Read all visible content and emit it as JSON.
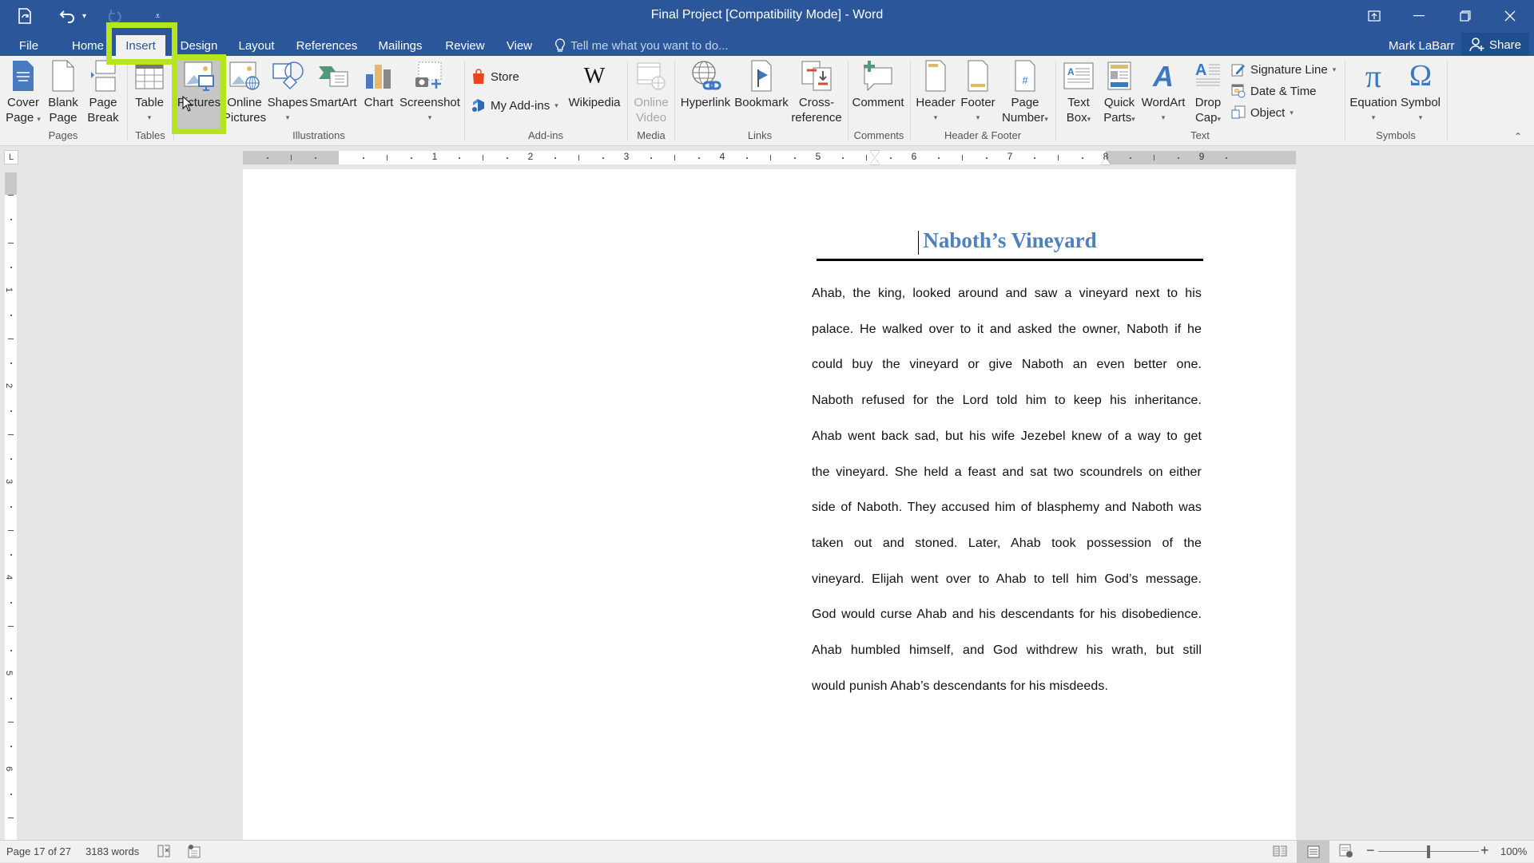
{
  "window": {
    "title": "Final Project [Compatibility Mode] - Word",
    "user": "Mark LaBarr",
    "share_label": "Share",
    "tell_me_placeholder": "Tell me what you want to do...",
    "qat": {
      "save_icon": "autosave-icon",
      "undo_icon": "undo-icon",
      "redo_icon": "redo-icon",
      "customize_icon": "customize-qat-icon"
    },
    "controls": [
      "ribbon-display-options",
      "minimize",
      "restore",
      "close"
    ]
  },
  "tabs": [
    {
      "label": "File"
    },
    {
      "label": "Home"
    },
    {
      "label": "Insert",
      "active": true
    },
    {
      "label": "Design"
    },
    {
      "label": "Layout"
    },
    {
      "label": "References"
    },
    {
      "label": "Mailings"
    },
    {
      "label": "Review"
    },
    {
      "label": "View"
    }
  ],
  "ribbon": {
    "groups": {
      "pages": "Pages",
      "tables": "Tables",
      "illustrations": "Illustrations",
      "addins": "Add-ins",
      "media": "Media",
      "links": "Links",
      "comments": "Comments",
      "header_footer": "Header & Footer",
      "text": "Text",
      "symbols": "Symbols"
    },
    "buttons": {
      "cover_page": [
        "Cover",
        "Page"
      ],
      "blank_page": [
        "Blank",
        "Page"
      ],
      "page_break": [
        "Page",
        "Break"
      ],
      "table": "Table",
      "pictures": "Pictures",
      "online_pictures": [
        "Online",
        "Pictures"
      ],
      "shapes": "Shapes",
      "smartart": "SmartArt",
      "chart": "Chart",
      "screenshot": "Screenshot",
      "store": "Store",
      "my_addins": "My Add-ins",
      "wikipedia": "Wikipedia",
      "online_video": [
        "Online",
        "Video"
      ],
      "hyperlink": "Hyperlink",
      "bookmark": "Bookmark",
      "cross_reference": [
        "Cross-",
        "reference"
      ],
      "comment": "Comment",
      "header": "Header",
      "footer": "Footer",
      "page_number": [
        "Page",
        "Number"
      ],
      "text_box": [
        "Text",
        "Box"
      ],
      "quick_parts": [
        "Quick",
        "Parts"
      ],
      "wordart": "WordArt",
      "drop_cap": [
        "Drop",
        "Cap"
      ],
      "signature_line": "Signature Line",
      "date_time": "Date & Time",
      "object": "Object",
      "equation": "Equation",
      "symbol": "Symbol"
    },
    "highlight_color": "#b5e61d"
  },
  "ruler": {
    "h_labels": [
      "1",
      "1",
      "2",
      "3",
      "4",
      "5",
      "6",
      "7",
      "8"
    ],
    "v_labels": [
      "1",
      "2",
      "3",
      "4",
      "5",
      "6"
    ]
  },
  "document": {
    "heading": "Naboth’s Vineyard",
    "heading_color": "#4f81bd",
    "lines": [
      "Ahab, the king, looked around and saw a vineyard next to his",
      "palace. He walked over to it and asked the owner, Naboth if he",
      "could buy the vineyard or give Naboth an even better one.",
      "Naboth refused for the Lord told him to keep his inheritance.",
      "Ahab went back sad, but his wife Jezebel knew of a way to get",
      "the vineyard. She held a feast and sat two scoundrels on either",
      "side of Naboth. They accused him of blasphemy and Naboth was",
      "taken out and stoned. Later, Ahab took possession of the",
      "vineyard. Elijah went over to Ahab to tell him God’s message.",
      "God would curse Ahab and his descendants for his disobedience.",
      "Ahab humbled himself, and God withdrew his wrath, but still",
      "would punish Ahab’s descendants for his misdeeds."
    ]
  },
  "status": {
    "page": "Page 17 of 27",
    "words": "3183 words",
    "zoom": "100%",
    "zoom_minus": "−",
    "zoom_plus": "+"
  }
}
